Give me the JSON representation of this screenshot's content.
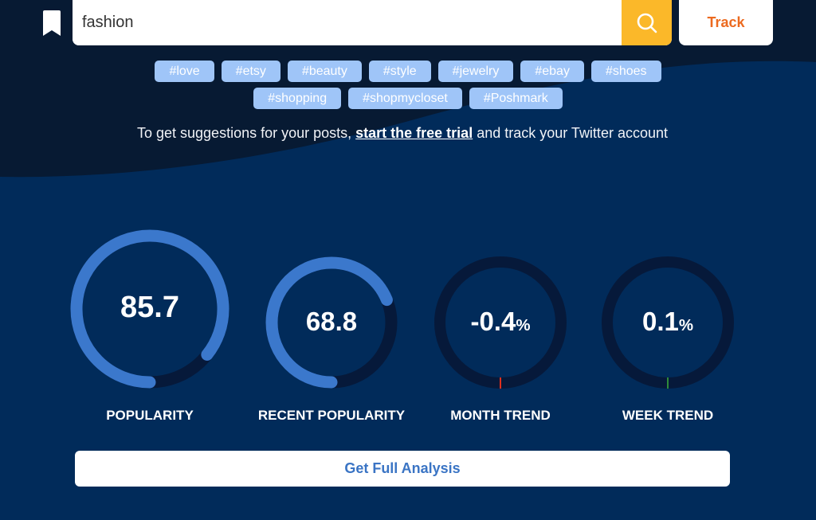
{
  "search": {
    "value": "fashion",
    "search_icon": "magnifier-icon",
    "track_label": "Track",
    "bookmark_icon": "bookmark-icon"
  },
  "tags": {
    "row1": [
      "#love",
      "#etsy",
      "#beauty",
      "#style",
      "#jewelry",
      "#ebay",
      "#shoes"
    ],
    "row2": [
      "#shopping",
      "#shopmycloset",
      "#Poshmark"
    ]
  },
  "promo": {
    "before": "To get suggestions for your posts, ",
    "link": "start the free trial",
    "after": " and track your Twitter account"
  },
  "gauges": [
    {
      "label": "POPULARITY",
      "value": "85.7",
      "suffix": "",
      "fraction": 0.857,
      "color": "#3b78cc"
    },
    {
      "label": "RECENT POPULARITY",
      "value": "68.8",
      "suffix": "",
      "fraction": 0.688,
      "color": "#3b78cc"
    },
    {
      "label": "MONTH TREND",
      "value": "-0.4",
      "suffix": "%",
      "fraction": -0.004,
      "color": "#e0301e"
    },
    {
      "label": "WEEK TREND",
      "value": "0.1",
      "suffix": "%",
      "fraction": 0.001,
      "color": "#2e8b3a"
    }
  ],
  "colors": {
    "bg_top": "#071a33",
    "bg_bottom": "#012b5a",
    "gauge_track": "#06193a",
    "accent_yellow": "#fbb829",
    "track_orange": "#ec6a1f",
    "tag_bg": "#9fc5f8"
  },
  "analysis_button": "Get Full Analysis"
}
